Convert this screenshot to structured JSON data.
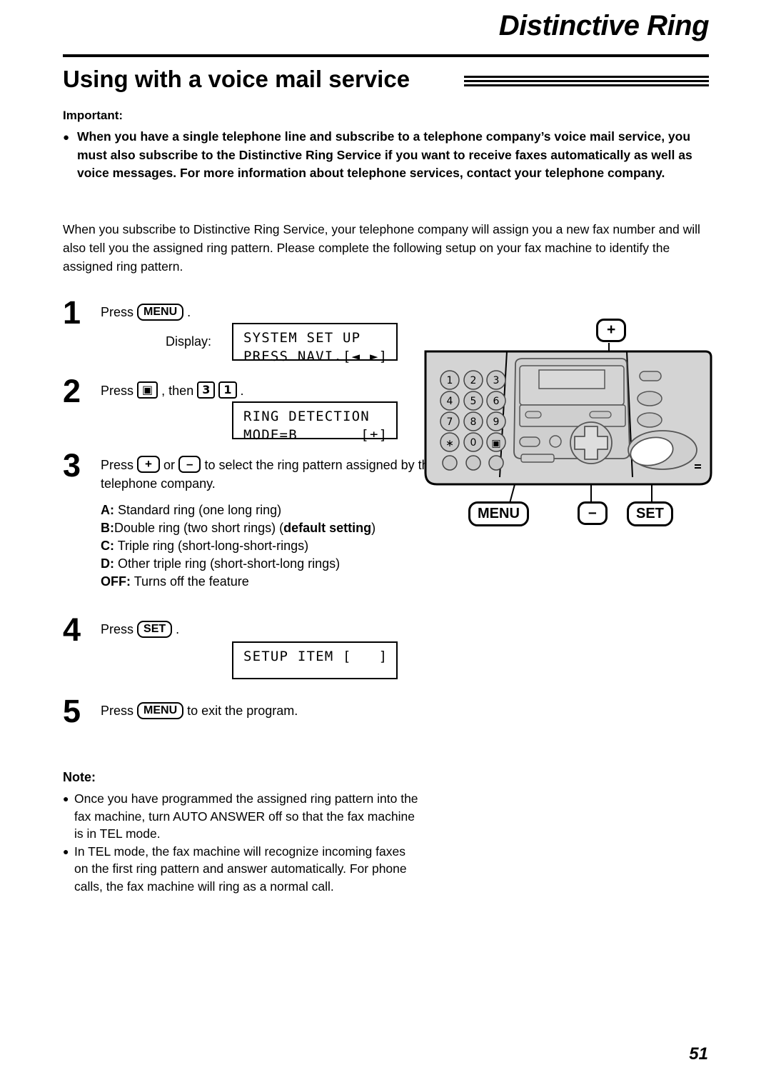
{
  "header": {
    "chapter_title": "Distinctive Ring",
    "section_title": "Using with a voice mail service"
  },
  "important": {
    "heading": "Important:",
    "bullet": "●",
    "text": "When you have a single telephone line and subscribe to a telephone company’s voice mail service, you must also subscribe to the Distinctive Ring Service if you want to receive faxes automatically as well as voice messages. For more information about telephone services, contact your telephone company."
  },
  "intro": {
    "text": "When you subscribe to Distinctive Ring Service, your telephone company will assign you a new fax number and will also tell you the assigned ring pattern. Please complete the following setup on your fax machine to identify the assigned ring pattern."
  },
  "steps": {
    "step1": {
      "number": "1",
      "press_word": "Press",
      "key": "MENU",
      "period": ".",
      "display_label": "Display:"
    },
    "step2": {
      "number": "2",
      "press_word": "Press",
      "key_hash": "▣",
      "then_word": ", then",
      "key_3": "3",
      "key_1": "1",
      "period": "."
    },
    "step3": {
      "number": "3",
      "press_word": "Press",
      "key_plus": "+",
      "or_word": "or",
      "key_minus": "–",
      "rest": "to select the ring pattern assigned by the telephone company."
    },
    "step4": {
      "number": "4",
      "press_word": "Press",
      "key": "SET",
      "period": "."
    },
    "step5": {
      "number": "5",
      "press_word": "Press",
      "key": "MENU",
      "rest": "to exit the program."
    }
  },
  "lcd": {
    "display1_line1": "SYSTEM SET UP",
    "display1_line2": "PRESS NAVI.[◄ ►]",
    "display2_line1": "RING DETECTION",
    "display2_line2": "MODE=B       [±]",
    "display3_line1": "SETUP ITEM [   ]",
    "display3_line2": ""
  },
  "ring_patterns": [
    {
      "label": "A:",
      "text": "Standard ring (one long ring)"
    },
    {
      "label": "B:",
      "text": "Double ring (two short rings) (",
      "bold_tail": "default setting",
      "close": ")"
    },
    {
      "label": "C:",
      "text": "Triple ring (short-long-short-rings)"
    },
    {
      "label": "D:",
      "text": "Other triple ring (short-short-long rings)"
    },
    {
      "label": "OFF:",
      "text": "Turns off the feature"
    }
  ],
  "note": {
    "heading": "Note:",
    "bullet": "●",
    "items": [
      "Once you have programmed the assigned ring pattern into the fax machine, turn AUTO ANSWER off so that the fax machine is in TEL mode.",
      "In TEL mode, the fax machine will recognize incoming faxes on the first ring pattern and answer automatically. For phone calls, the fax machine will ring as a normal call."
    ]
  },
  "illustration": {
    "callout_plus": "+",
    "callout_minus": "–",
    "callout_menu": "MENU",
    "callout_set": "SET",
    "keypad_keys": [
      "1",
      "2",
      "3",
      "4",
      "5",
      "6",
      "7",
      "8",
      "9",
      "∗",
      "0",
      "▣"
    ],
    "panel_fill": "#d4d4d4",
    "panel_stroke": "#000000",
    "button_fill": "#c9c9c9"
  },
  "page_number": "51"
}
